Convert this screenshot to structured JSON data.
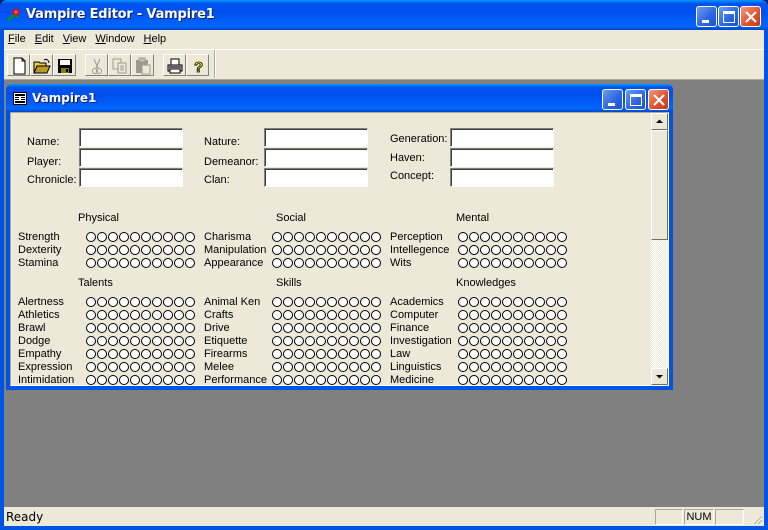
{
  "app": {
    "title": "Vampire Editor - Vampire1",
    "menu": [
      {
        "label": "File",
        "accel": "F",
        "rest": "ile"
      },
      {
        "label": "Edit",
        "accel": "E",
        "rest": "dit"
      },
      {
        "label": "View",
        "accel": "V",
        "rest": "iew"
      },
      {
        "label": "Window",
        "accel": "W",
        "rest": "indow"
      },
      {
        "label": "Help",
        "accel": "H",
        "rest": "elp"
      }
    ],
    "toolbar": [
      {
        "name": "new",
        "icon": "new-document-icon",
        "enabled": true
      },
      {
        "name": "open",
        "icon": "open-folder-icon",
        "enabled": true
      },
      {
        "name": "save",
        "icon": "save-disk-icon",
        "enabled": true
      },
      {
        "name": "cut",
        "icon": "scissors-icon",
        "enabled": false
      },
      {
        "name": "copy",
        "icon": "copy-icon",
        "enabled": false
      },
      {
        "name": "paste",
        "icon": "paste-clipboard-icon",
        "enabled": false
      },
      {
        "name": "print",
        "icon": "printer-icon",
        "enabled": true
      },
      {
        "name": "help",
        "icon": "help-question-icon",
        "enabled": true
      }
    ],
    "status": {
      "text": "Ready",
      "panes": [
        "",
        "NUM",
        ""
      ]
    }
  },
  "document": {
    "title": "Vampire1",
    "fields": {
      "col1": [
        {
          "label": "Name:",
          "value": ""
        },
        {
          "label": "Player:",
          "value": ""
        },
        {
          "label": "Chronicle:",
          "value": ""
        }
      ],
      "col2": [
        {
          "label": "Nature:",
          "value": ""
        },
        {
          "label": "Demeanor:",
          "value": ""
        },
        {
          "label": "Clan:",
          "value": ""
        }
      ],
      "col3": [
        {
          "label": "Generation:",
          "value": ""
        },
        {
          "label": "Haven:",
          "value": ""
        },
        {
          "label": "Concept:",
          "value": ""
        }
      ]
    },
    "dots_per_trait": 10,
    "attributes": {
      "heading": [
        "Physical",
        "Social",
        "Mental"
      ],
      "groups": [
        [
          {
            "name": "Strength",
            "value": 0
          },
          {
            "name": "Dexterity",
            "value": 0
          },
          {
            "name": "Stamina",
            "value": 0
          }
        ],
        [
          {
            "name": "Charisma",
            "value": 0
          },
          {
            "name": "Manipulation",
            "value": 0
          },
          {
            "name": "Appearance",
            "value": 0
          }
        ],
        [
          {
            "name": "Perception",
            "value": 0
          },
          {
            "name": "Intellegence",
            "value": 0
          },
          {
            "name": "Wits",
            "value": 0
          }
        ]
      ]
    },
    "abilities": {
      "heading": [
        "Talents",
        "Skills",
        "Knowledges"
      ],
      "groups": [
        [
          {
            "name": "Alertness",
            "value": 0
          },
          {
            "name": "Athletics",
            "value": 0
          },
          {
            "name": "Brawl",
            "value": 0
          },
          {
            "name": "Dodge",
            "value": 0
          },
          {
            "name": "Empathy",
            "value": 0
          },
          {
            "name": "Expression",
            "value": 0
          },
          {
            "name": "Intimidation",
            "value": 0
          }
        ],
        [
          {
            "name": "Animal Ken",
            "value": 0
          },
          {
            "name": "Crafts",
            "value": 0
          },
          {
            "name": "Drive",
            "value": 0
          },
          {
            "name": "Etiquette",
            "value": 0
          },
          {
            "name": "Firearms",
            "value": 0
          },
          {
            "name": "Melee",
            "value": 0
          },
          {
            "name": "Performance",
            "value": 0
          }
        ],
        [
          {
            "name": "Academics",
            "value": 0
          },
          {
            "name": "Computer",
            "value": 0
          },
          {
            "name": "Finance",
            "value": 0
          },
          {
            "name": "Investigation",
            "value": 0
          },
          {
            "name": "Law",
            "value": 0
          },
          {
            "name": "Linguistics",
            "value": 0
          },
          {
            "name": "Medicine",
            "value": 0
          }
        ]
      ]
    },
    "scrollbar": {
      "position": 0.0
    }
  }
}
